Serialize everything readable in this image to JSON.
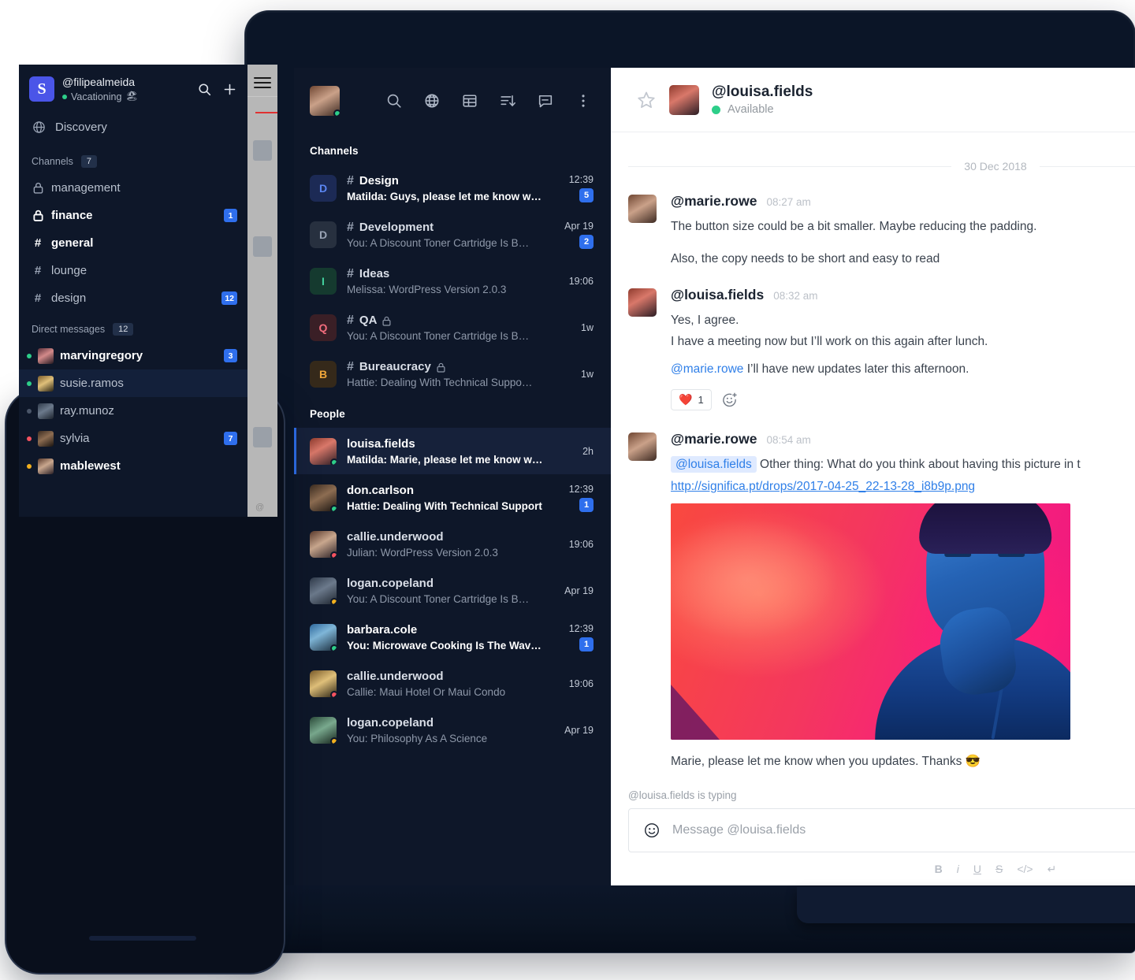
{
  "desktop": {
    "sidebar": {
      "current_user": {
        "status": "online"
      },
      "toolbar": [
        {
          "name": "search-icon",
          "label": "Search"
        },
        {
          "name": "globe-icon",
          "label": "Directory"
        },
        {
          "name": "table-icon",
          "label": "Admin"
        },
        {
          "name": "sort-icon",
          "label": "Sort"
        },
        {
          "name": "new-message-icon",
          "label": "Create new"
        },
        {
          "name": "kebab-menu-icon",
          "label": "More"
        }
      ],
      "sections": [
        {
          "title": "Channels",
          "items": [
            {
              "initial": "D",
              "name": "Design",
              "preview": "Matilda: Guys, please let me know wh…",
              "time": "12:39",
              "badge": "5",
              "private": false,
              "unread": true,
              "sq_bg": "#1c2a55",
              "sq_fg": "#5b86f2"
            },
            {
              "initial": "D",
              "name": "Development",
              "preview": "You: A Discount Toner Cartridge Is B…",
              "time": "Apr 19",
              "badge": "2",
              "private": false,
              "unread": false,
              "sq_bg": "#27303f",
              "sq_fg": "#9aa4b5"
            },
            {
              "initial": "I",
              "name": "Ideas",
              "preview": "Melissa: WordPress Version 2.0.3",
              "time": "19:06",
              "badge": "",
              "private": false,
              "unread": false,
              "sq_bg": "#153a2f",
              "sq_fg": "#43d19e"
            },
            {
              "initial": "Q",
              "name": "QA",
              "preview": "You: A Discount Toner Cartridge Is B…",
              "time": "1w",
              "badge": "",
              "private": true,
              "unread": false,
              "sq_bg": "#3a1f26",
              "sq_fg": "#f26d7d"
            },
            {
              "initial": "B",
              "name": "Bureaucracy",
              "preview": "Hattie: Dealing With Technical Suppo…",
              "time": "1w",
              "badge": "",
              "private": true,
              "unread": false,
              "sq_bg": "#35291a",
              "sq_fg": "#f0a63a"
            }
          ]
        },
        {
          "title": "People",
          "items": [
            {
              "name": "louisa.fields",
              "preview": "Matilda: Marie, please let me know w…",
              "time": "2h",
              "badge": "",
              "presence": "green",
              "selected": true,
              "unread": true,
              "portrait": "p2"
            },
            {
              "name": "don.carlson",
              "preview": "Hattie: Dealing With Technical Support",
              "time": "12:39",
              "badge": "1",
              "presence": "green",
              "selected": false,
              "unread": true,
              "portrait": "p7"
            },
            {
              "name": "callie.underwood",
              "preview": "Julian: WordPress Version 2.0.3",
              "time": "19:06",
              "badge": "",
              "presence": "red",
              "selected": false,
              "unread": false,
              "portrait": "p4"
            },
            {
              "name": "logan.copeland",
              "preview": "You: A Discount Toner Cartridge Is B…",
              "time": "Apr 19",
              "badge": "",
              "presence": "amber",
              "selected": false,
              "unread": false,
              "portrait": "p3"
            },
            {
              "name": "barbara.cole",
              "preview": "You: Microwave Cooking Is The Wav…",
              "time": "12:39",
              "badge": "1",
              "presence": "green",
              "selected": false,
              "unread": true,
              "portrait": "p5"
            },
            {
              "name": "callie.underwood",
              "preview": "Callie: Maui Hotel Or Maui Condo",
              "time": "19:06",
              "badge": "",
              "presence": "red",
              "selected": false,
              "unread": false,
              "portrait": "p6"
            },
            {
              "name": "logan.copeland",
              "preview": "You: Philosophy As A Science",
              "time": "Apr 19",
              "badge": "",
              "presence": "amber",
              "selected": false,
              "unread": false,
              "portrait": "p9"
            }
          ]
        }
      ]
    },
    "chat": {
      "header": {
        "favorite_icon": "star-icon",
        "title": "@louisa.fields",
        "status": "Available",
        "status_color": "#2dce89"
      },
      "day_separator": "30 Dec 2018",
      "messages": [
        {
          "author": "@marie.rowe",
          "time": "08:27 am",
          "portrait": "p1",
          "lines": [
            "The button size could be a bit smaller. Maybe reducing the padding.",
            "Also, the copy needs to be short and easy to read"
          ]
        },
        {
          "author": "@louisa.fields",
          "time": "08:32 am",
          "portrait": "p2",
          "lines": [
            "Yes, I agree.",
            "I have a meeting now but I’ll work on this again after lunch."
          ],
          "mention_line": {
            "mention": "@marie.rowe",
            "rest": " I’ll have new updates later this afternoon."
          },
          "reaction": {
            "emoji": "❤️",
            "count": "1",
            "add_icon": "add-reaction-icon"
          }
        },
        {
          "author": "@marie.rowe",
          "time": "08:54 am",
          "portrait": "p1",
          "mention_line_hl": {
            "mention": "@louisa.fields",
            "rest": "Other thing: What do you think about having this picture in t"
          },
          "link": "http://significa.pt/drops/2017-04-25_22-13-28_i8b9p.png",
          "attachment_alt": "singer-photo",
          "closing_line": "Marie, please let me know when you updates. Thanks 😎"
        }
      ],
      "typing_indicator": "@louisa.fields is typing",
      "composer": {
        "emoji_icon": "emoji-icon",
        "placeholder": "Message @louisa.fields",
        "value": ""
      },
      "format_bar": [
        "B",
        "i",
        "U",
        "S",
        "</>",
        "↵"
      ]
    }
  },
  "phone": {
    "peek": {
      "at_symbol": "@"
    },
    "header": {
      "workspace_initial": "S",
      "workspace_color": "#4a55e8",
      "username": "@filipealmeida",
      "status": "Vacationing",
      "status_emoji": "🏖",
      "search_icon": "search-icon",
      "add_icon": "plus-icon"
    },
    "discovery": {
      "icon": "globe-icon",
      "label": "Discovery"
    },
    "channels_section": {
      "label": "Channels",
      "count": "7"
    },
    "channels": [
      {
        "name": "management",
        "glyph": "lock",
        "badge": "",
        "unread": false,
        "selected": false
      },
      {
        "name": "finance",
        "glyph": "lock",
        "badge": "1",
        "unread": true,
        "selected": false
      },
      {
        "name": "general",
        "glyph": "hash",
        "badge": "",
        "unread": true,
        "selected": false
      },
      {
        "name": "lounge",
        "glyph": "hash",
        "badge": "",
        "unread": false,
        "selected": false
      },
      {
        "name": "design",
        "glyph": "hash",
        "badge": "12",
        "unread": false,
        "selected": false
      }
    ],
    "dm_section": {
      "label": "Direct messages",
      "count": "12"
    },
    "dms": [
      {
        "name": "marvingregory",
        "presence": "#2dce89",
        "badge": "3",
        "unread": true,
        "selected": false,
        "portrait": "p8"
      },
      {
        "name": "susie.ramos",
        "presence": "#2dce89",
        "badge": "",
        "unread": false,
        "selected": true,
        "portrait": "p6"
      },
      {
        "name": "ray.munoz",
        "presence": "#4a5568",
        "badge": "",
        "unread": false,
        "selected": false,
        "portrait": "p3"
      },
      {
        "name": "sylvia",
        "presence": "#f5525f",
        "badge": "7",
        "unread": false,
        "selected": false,
        "portrait": "p7"
      },
      {
        "name": "mablewest",
        "presence": "#f2b01e",
        "badge": "",
        "unread": true,
        "selected": false,
        "portrait": "p4"
      }
    ]
  }
}
